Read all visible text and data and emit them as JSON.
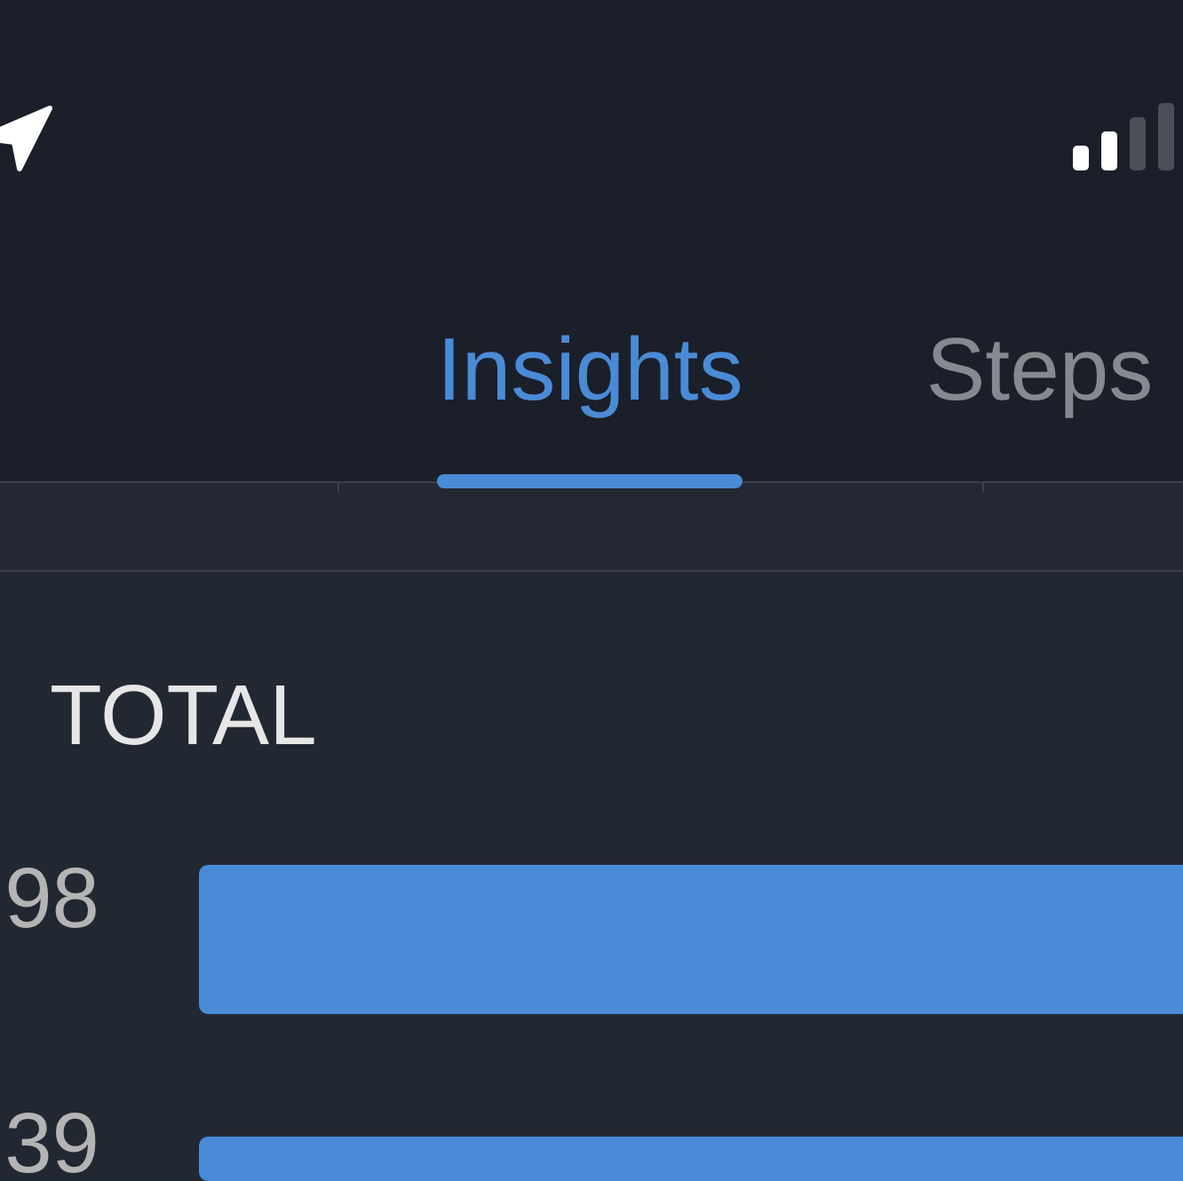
{
  "tabs": [
    {
      "label": "Insights",
      "selected": true
    },
    {
      "label": "Steps",
      "selected": false
    }
  ],
  "section": {
    "title": "TOTAL"
  },
  "rows": [
    {
      "label": "98"
    },
    {
      "label": "39"
    }
  ]
}
